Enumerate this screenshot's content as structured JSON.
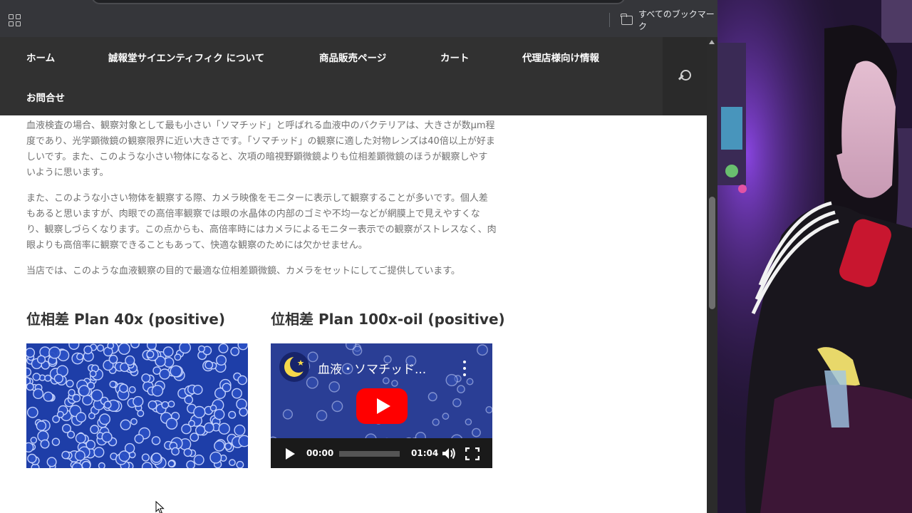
{
  "bookmarks_bar": {
    "all_bookmarks_label": "すべてのブックマーク"
  },
  "nav": {
    "items": [
      {
        "label": "ホーム"
      },
      {
        "label": "誠報堂サイエンティフィク について"
      },
      {
        "label": "商品販売ページ"
      },
      {
        "label": "カート"
      },
      {
        "label": "代理店様向け情報"
      },
      {
        "label": "お問合せ"
      }
    ]
  },
  "article": {
    "paragraphs": [
      "血液検査の場合、観察対象として最も小さい「ソマチッド」と呼ばれる血液中のバクテリアは、大きさが数μm程度であり、光学顕微鏡の観察限界に近い大きさです。「ソマチッド」の観察に適した対物レンズは40倍以上が好ましいです。また、このような小さい物体になると、次項の暗視野顕微鏡よりも位相差顕微鏡のほうが観察しやすいように思います。",
      "また、このような小さい物体を観察する際、カメラ映像をモニターに表示して観察することが多いです。個人差もあると思いますが、肉眼での高倍率観察では眼の水晶体の内部のゴミや不均一などが網膜上で見えやすくなり、観察しづらくなります。この点からも、高倍率時にはカメラによるモニター表示での観察がストレスなく、肉眼よりも高倍率に観察できることもあって、快適な観察のためには欠かせません。",
      "当店では、このような血液観察の目的で最適な位相差顕微鏡、カメラをセットにしてご提供しています。"
    ],
    "heading_left": "位相差 Plan 40x (positive)",
    "heading_right": "位相差 Plan 100x-oil (positive)"
  },
  "video": {
    "title": "血液・ソマチッド...",
    "current_time": "00:00",
    "duration": "01:04",
    "progress": 0
  },
  "colors": {
    "nav_bg": "#313131",
    "bookmarks_bg": "#35363a",
    "body_text": "#707070",
    "youtube_red": "#ff0000",
    "micro_blue": "#1e3ea8"
  }
}
